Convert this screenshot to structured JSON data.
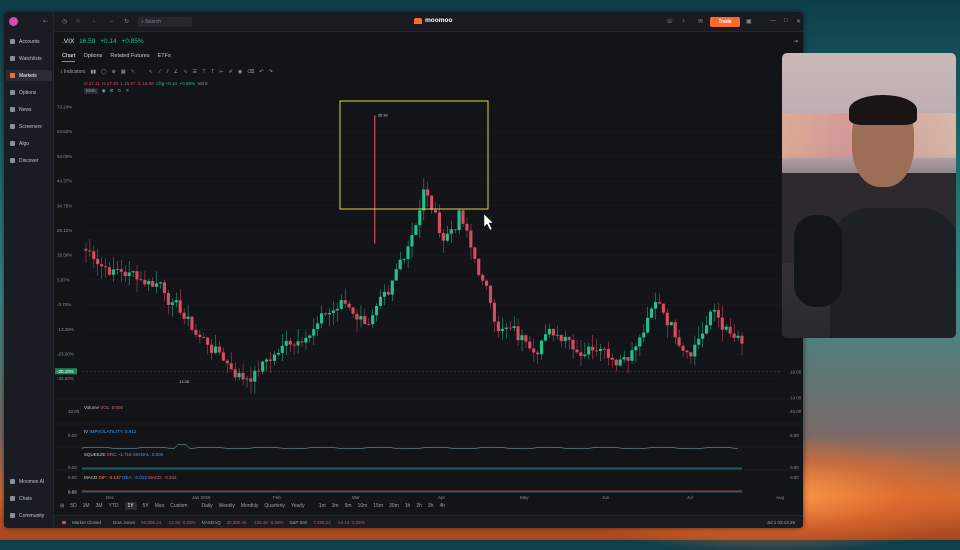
{
  "sidebar": {
    "items": [
      {
        "label": "Accounts",
        "icon": "accounts-icon"
      },
      {
        "label": "Watchlists",
        "icon": "heart-icon"
      },
      {
        "label": "Markets",
        "icon": "markets-icon",
        "active": true
      },
      {
        "label": "Options",
        "icon": "options-icon"
      },
      {
        "label": "News",
        "icon": "news-icon"
      },
      {
        "label": "Screeners",
        "icon": "screener-icon"
      },
      {
        "label": "Algo",
        "icon": "algo-icon"
      },
      {
        "label": "Discover",
        "icon": "discover-icon"
      }
    ],
    "bottom": [
      {
        "label": "Moomoo AI",
        "icon": "ai-icon"
      },
      {
        "label": "Chats",
        "icon": "chat-icon"
      },
      {
        "label": "Community",
        "icon": "community-icon"
      }
    ]
  },
  "topbar": {
    "search_placeholder": "Search",
    "brand": "moomoo",
    "trade_label": "Trade"
  },
  "quote": {
    "symbol": ".VIX",
    "price": "16.59",
    "change": "+0.14",
    "change_pct": "+0.85%"
  },
  "tabs": [
    "Chart",
    "Options",
    "Related Futures",
    "ETFs"
  ],
  "toolbar": {
    "indicators_label": "Indicators"
  },
  "ohlc": {
    "o": "O 17.11",
    "h": "H 17.30",
    "l": "L 15.97",
    "c": "C 16.59",
    "chg": "Chg +0.14",
    "chg_pct": "+0.85%",
    "vol": "Vol 0"
  },
  "ema_label": "EMA",
  "colors": {
    "up": "#21c28a",
    "down": "#d94a64",
    "accent": "#ff6a2c",
    "highlight": "#e0d43a"
  },
  "chart_data": {
    "type": "candlestick",
    "y_ticks": [
      "73.24%",
      "63.62%",
      "54.00%",
      "44.37%",
      "34.75%",
      "25.12%",
      "15.50%",
      "5.87%",
      "-3.75%",
      "-13.38%",
      "-23.00%",
      "-32.63%"
    ],
    "current_label": "-20.18%",
    "right_ticks": [
      "16.00",
      "14.00"
    ],
    "x_ticks": [
      "Dec",
      "Jan 2026",
      "Feb",
      "Mar",
      "Apr",
      "May",
      "Jun",
      "Jul",
      "Aug"
    ],
    "max_label": "35.30",
    "min_label": "13.38",
    "volume": {
      "label": "Volume",
      "value": "VOL: 0.000",
      "ticks": [
        "40.00",
        "5.00"
      ]
    },
    "iv": {
      "label": "IV",
      "value": "IMPVOLATILITY: 0.912"
    },
    "squeeze": {
      "label": "SQUEEZE",
      "value": "SRC: -1.718",
      "signal": "SIGNAL: 0.000",
      "ticks": [
        "0.00",
        "0.00"
      ]
    },
    "macd": {
      "label": "MACD",
      "dif": "DIF: -0.137",
      "dea": "DEA: -0.013",
      "macd": "MACD: -0.244",
      "ticks": [
        "0.00",
        "0.00"
      ]
    }
  },
  "periods": [
    "5D",
    "1M",
    "3M",
    "YTD",
    "1Y",
    "5Y",
    "Max",
    "Custom",
    "Daily",
    "Weekly",
    "Monthly",
    "Quarterly",
    "Yearly",
    "1m",
    "3m",
    "5m",
    "10m",
    "15m",
    "30m",
    "1h",
    "2h",
    "3h",
    "4h"
  ],
  "active_period": "1Y",
  "status": {
    "market": "Market Closed",
    "dow_label": "Dow Jones",
    "dow_value": "50,905.24",
    "dow_chg": "-12.96 -0.03%",
    "nasdaq_label": "NASDAQ",
    "nasdaq_value": "28,890.45",
    "nasdaq_chg": "-133.45 -0.46%",
    "sp_label": "S&P 500",
    "sp_value": "7,435.23",
    "sp_chg": "-14.13 -0.25%",
    "time": "Jul 1 03:13:25"
  }
}
